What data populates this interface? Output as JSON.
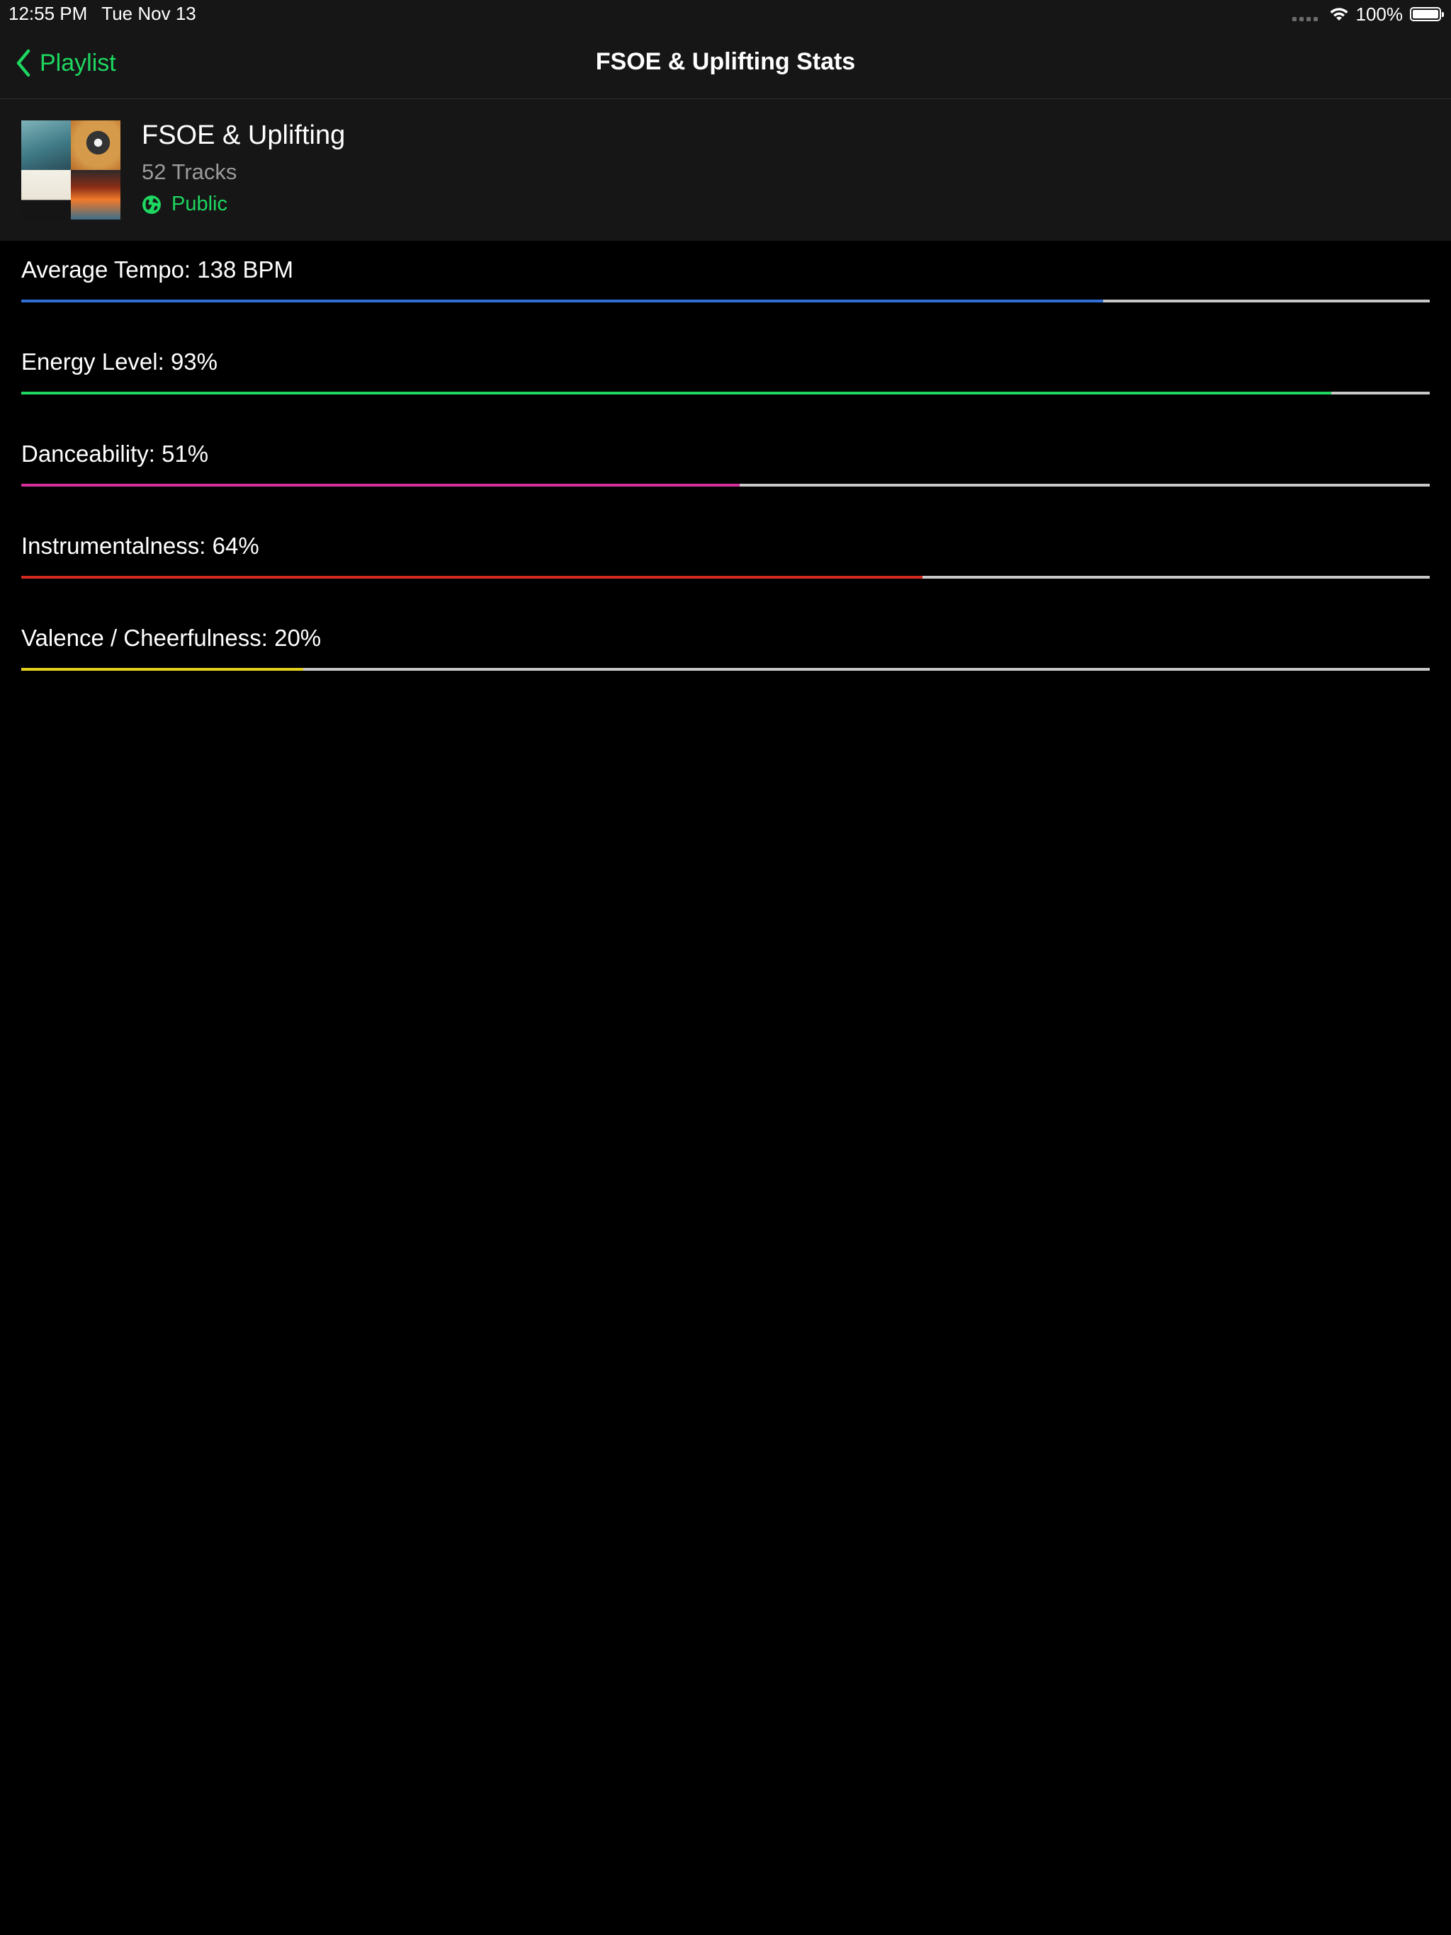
{
  "status_bar": {
    "time": "12:55 PM",
    "date": "Tue Nov 13",
    "battery_percent": "100%",
    "icons": [
      "cellular-signal-icon",
      "wifi-icon",
      "battery-icon"
    ]
  },
  "nav": {
    "back_label": "Playlist",
    "back_icon": "chevron-left-icon",
    "title": "FSOE & Uplifting Stats"
  },
  "playlist": {
    "name": "FSOE & Uplifting",
    "tracks": "52 Tracks",
    "visibility": "Public",
    "visibility_icon": "globe-icon"
  },
  "stats": [
    {
      "label": "Average Tempo: 138 BPM",
      "fraction": 0.768,
      "color": "#2f6fd6"
    },
    {
      "label": "Energy Level: 93%",
      "fraction": 0.93,
      "color": "#1ed760"
    },
    {
      "label": "Danceability: 51%",
      "fraction": 0.51,
      "color": "#d6309a"
    },
    {
      "label": "Instrumentalness: 64%",
      "fraction": 0.64,
      "color": "#d22a1e"
    },
    {
      "label": "Valence / Cheerfulness: 20%",
      "fraction": 0.2,
      "color": "#e6d21c"
    }
  ],
  "colors": {
    "accent": "#1ed760",
    "bar_background": "#161616",
    "track": "#c8c8c8"
  }
}
